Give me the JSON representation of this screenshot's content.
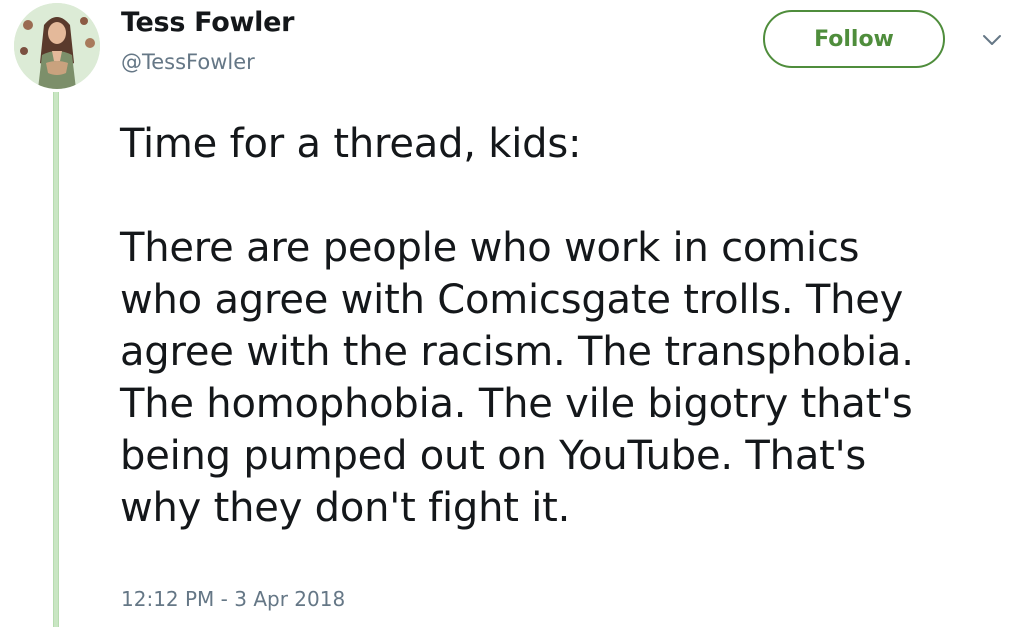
{
  "author": {
    "display_name": "Tess Fowler",
    "handle": "@TessFowler",
    "avatar_icon": "profile-illustration-avatar"
  },
  "actions": {
    "follow_label": "Follow",
    "menu_icon": "chevron-down-icon"
  },
  "tweet": {
    "paragraph_1": "Time for a thread, kids:",
    "paragraph_2": "There are people who work in comics\nwho agree with Comicsgate trolls. They\nagree with the racism. The transphobia.\nThe homophobia. The vile bigotry that's\nbeing pumped out on YouTube. That's\nwhy they don't fight it.",
    "timestamp": "12:12 PM - 3 Apr 2018"
  },
  "colors": {
    "accent": "#4f8d3c",
    "thread_line": "#c9e6c3",
    "secondary_text": "#657786",
    "primary_text": "#14171a"
  }
}
